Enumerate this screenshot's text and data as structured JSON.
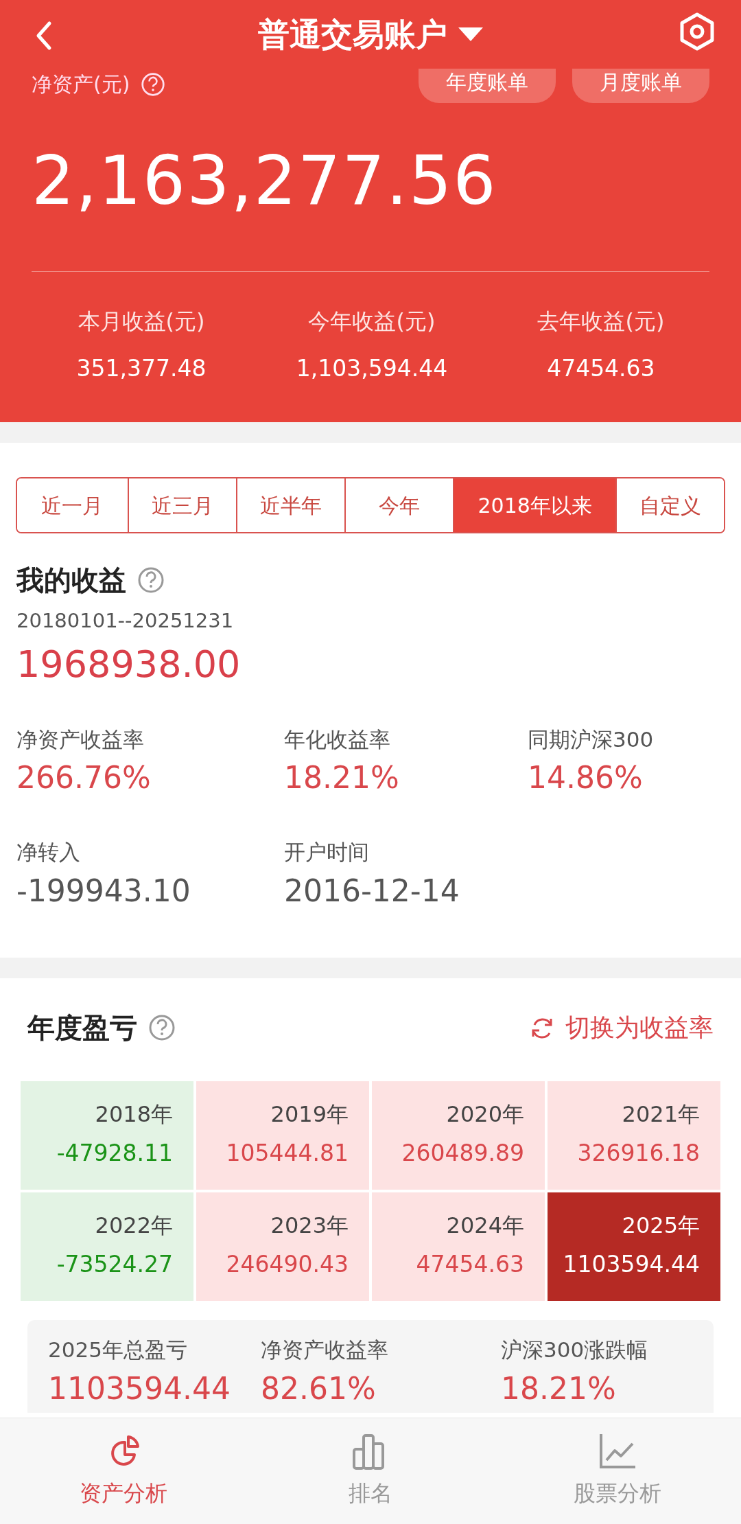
{
  "header": {
    "title": "普通交易账户",
    "net_asset_label": "净资产(元)",
    "bill_buttons": [
      "年度账单",
      "月度账单"
    ],
    "net_asset": "2,163,277.56",
    "stats": [
      {
        "label": "本月收益(元)",
        "value": "351,377.48"
      },
      {
        "label": "今年收益(元)",
        "value": "1,103,594.44"
      },
      {
        "label": "去年收益(元)",
        "value": "47454.63"
      }
    ]
  },
  "period_tabs": [
    {
      "label": "近一月",
      "selected": false
    },
    {
      "label": "近三月",
      "selected": false
    },
    {
      "label": "近半年",
      "selected": false
    },
    {
      "label": "今年",
      "selected": false
    },
    {
      "label": "2018年以来",
      "selected": true
    },
    {
      "label": "自定义",
      "selected": false
    }
  ],
  "my_profit": {
    "title": "我的收益",
    "date_range": "20180101--20251231",
    "amount": "1968938.00",
    "metrics": [
      {
        "label": "净资产收益率",
        "value": "266.76%",
        "kind": "highlight"
      },
      {
        "label": "年化收益率",
        "value": "18.21%",
        "kind": "highlight"
      },
      {
        "label": "同期沪深300",
        "value": "14.86%",
        "kind": "highlight"
      },
      {
        "label": "净转入",
        "value": "-199943.10",
        "kind": "plain"
      },
      {
        "label": "开户时间",
        "value": "2016-12-14",
        "kind": "plain"
      }
    ]
  },
  "annual": {
    "title": "年度盈亏",
    "switch_label": "切换为收益率",
    "years": [
      {
        "year": "2018年",
        "value": "-47928.11",
        "kind": "loss",
        "selected": false
      },
      {
        "year": "2019年",
        "value": "105444.81",
        "kind": "gain",
        "selected": false
      },
      {
        "year": "2020年",
        "value": "260489.89",
        "kind": "gain",
        "selected": false
      },
      {
        "year": "2021年",
        "value": "326916.18",
        "kind": "gain",
        "selected": false
      },
      {
        "year": "2022年",
        "value": "-73524.27",
        "kind": "loss",
        "selected": false
      },
      {
        "year": "2023年",
        "value": "246490.43",
        "kind": "gain",
        "selected": false
      },
      {
        "year": "2024年",
        "value": "47454.63",
        "kind": "gain",
        "selected": false
      },
      {
        "year": "2025年",
        "value": "1103594.44",
        "kind": "gain",
        "selected": true
      }
    ],
    "summary": [
      {
        "label": "2025年总盈亏",
        "value": "1103594.44"
      },
      {
        "label": "净资产收益率",
        "value": "82.61%"
      },
      {
        "label": "沪深300涨跌幅",
        "value": "18.21%"
      }
    ]
  },
  "bottom_nav": [
    {
      "label": "资产分析",
      "selected": true
    },
    {
      "label": "排名",
      "selected": false
    },
    {
      "label": "股票分析",
      "selected": false
    }
  ]
}
